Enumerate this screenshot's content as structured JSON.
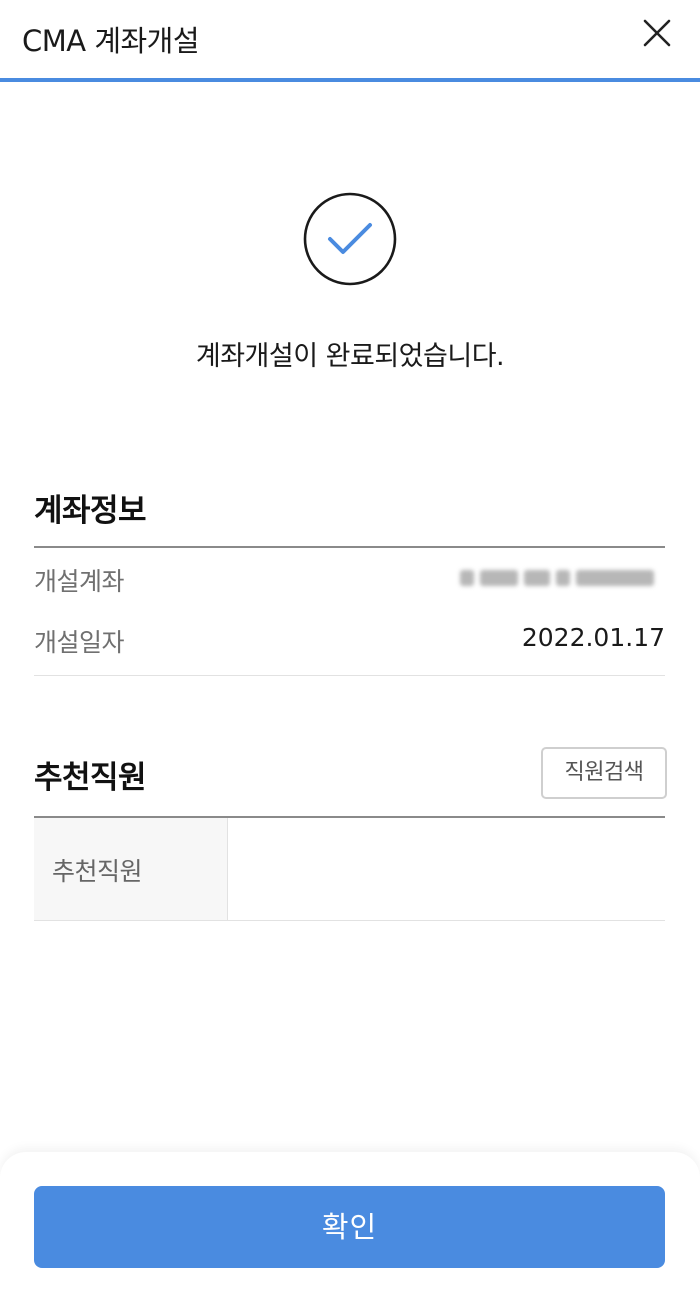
{
  "header": {
    "title": "CMA 계좌개설",
    "close_icon": "close-icon",
    "accent_color": "#4a8be0"
  },
  "result": {
    "icon": "check-circle-icon",
    "message": "계좌개설이 완료되었습니다."
  },
  "account_info": {
    "title": "계좌정보",
    "rows": [
      {
        "label": "개설계좌",
        "value": "",
        "masked": true
      },
      {
        "label": "개설일자",
        "value": "2022.01.17"
      }
    ]
  },
  "referrer": {
    "title": "추천직원",
    "search_button": "직원검색",
    "field_label": "추천직원",
    "field_value": ""
  },
  "footer": {
    "confirm_label": "확인"
  }
}
